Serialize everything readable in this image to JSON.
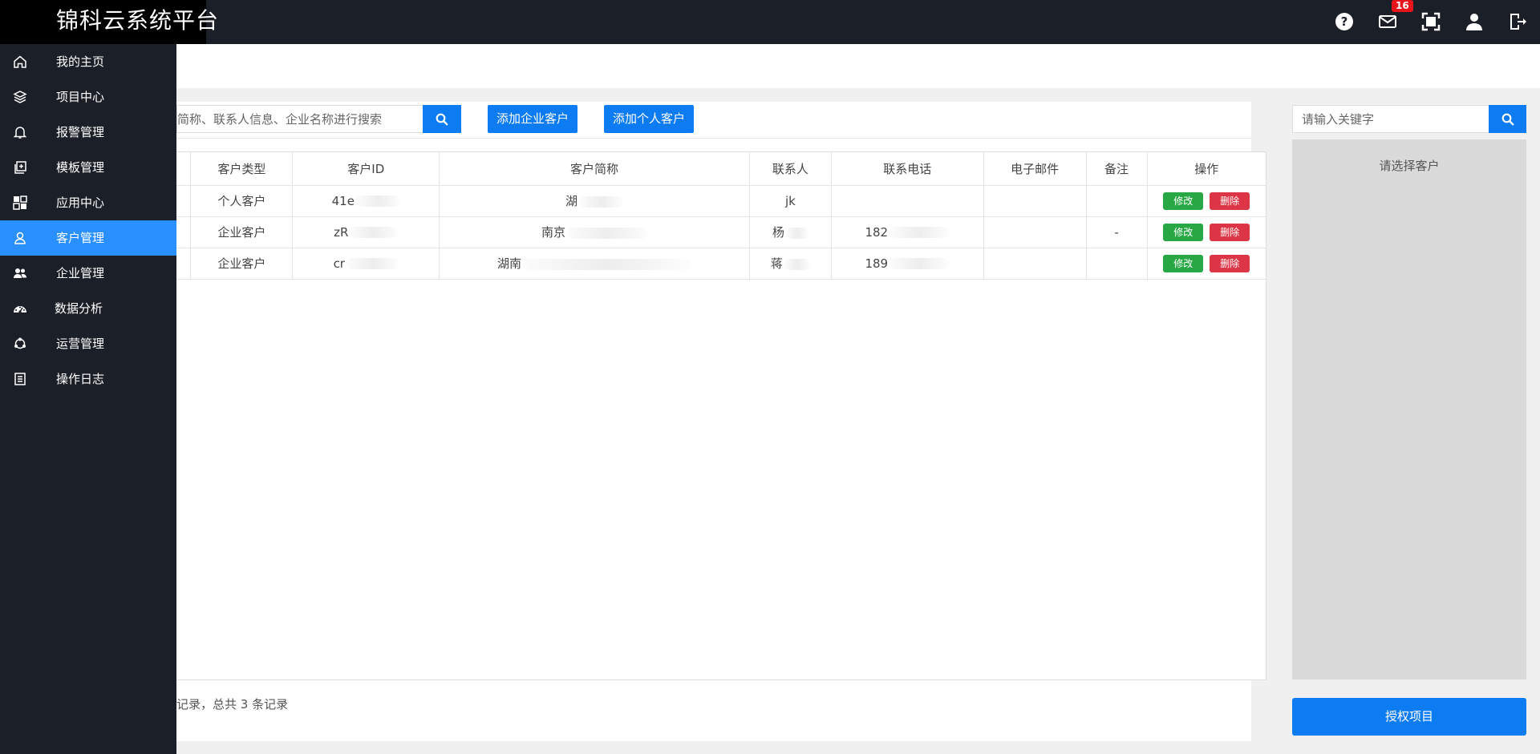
{
  "brand": {
    "title": "锦科云系统平台"
  },
  "topbar": {
    "mail_badge": "16"
  },
  "sidebar": {
    "items": [
      {
        "label": "我的主页",
        "icon": "home-icon"
      },
      {
        "label": "项目中心",
        "icon": "layers-icon"
      },
      {
        "label": "报警管理",
        "icon": "bell-icon"
      },
      {
        "label": "模板管理",
        "icon": "template-icon"
      },
      {
        "label": "应用中心",
        "icon": "apps-icon"
      },
      {
        "label": "客户管理",
        "icon": "user-icon",
        "active": true
      },
      {
        "label": "企业管理",
        "icon": "users-icon"
      },
      {
        "label": "数据分析",
        "icon": "dashboard-icon"
      },
      {
        "label": "运营管理",
        "icon": "cycle-icon"
      },
      {
        "label": "操作日志",
        "icon": "log-icon"
      }
    ]
  },
  "toolbar": {
    "search_placeholder": "简称、联系人信息、企业名称进行搜索",
    "add_enterprise": "添加企业客户",
    "add_personal": "添加个人客户"
  },
  "table": {
    "headers": [
      "客户类型",
      "客户ID",
      "客户简称",
      "联系人",
      "联系电话",
      "电子邮件",
      "备注",
      "操作"
    ],
    "rows": [
      {
        "type": "个人客户",
        "id": "41e",
        "name": "湖",
        "contact": "jk",
        "phone": "",
        "email": "",
        "note": ""
      },
      {
        "type": "企业客户",
        "id": "zR",
        "name": "南京",
        "contact": "杨",
        "phone": "182",
        "email": "",
        "note": "-"
      },
      {
        "type": "企业客户",
        "id": "cr",
        "name": "湖南",
        "contact": "蒋",
        "phone": "189",
        "email": "",
        "note": ""
      }
    ],
    "edit_label": "修改",
    "delete_label": "删除"
  },
  "footer": {
    "summary": "记录，总共 3 条记录"
  },
  "right_panel": {
    "search_placeholder": "请输入关键字",
    "empty_text": "请选择客户",
    "auth_button": "授权项目"
  }
}
